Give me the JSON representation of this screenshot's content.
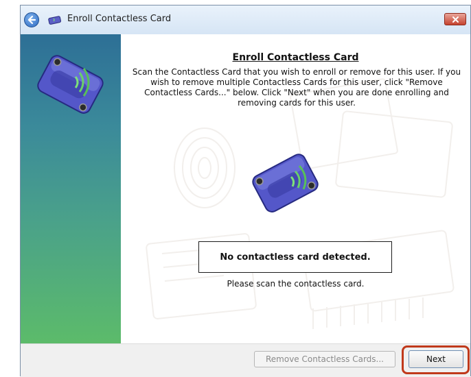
{
  "window": {
    "title": "Enroll Contactless Card"
  },
  "content": {
    "heading": "Enroll Contactless Card",
    "instructions": "Scan the Contactless Card that you wish to enroll or remove for this user. If you wish to remove multiple Contactless Cards for this user, click \"Remove Contactless Cards...\" below. Click \"Next\" when you are done enrolling and removing cards for this user.",
    "status": "No contactless card detected.",
    "hint": "Please scan the contactless card."
  },
  "footer": {
    "remove_label": "Remove Contactless Cards...",
    "next_label": "Next"
  },
  "colors": {
    "highlight": "#c0391b",
    "sidebar_top": "#2d6f96",
    "sidebar_bottom": "#5cbb6a"
  },
  "icons": {
    "back": "back-arrow-icon",
    "title": "card-reader-icon",
    "close": "close-icon",
    "reader": "contactless-reader-icon"
  }
}
